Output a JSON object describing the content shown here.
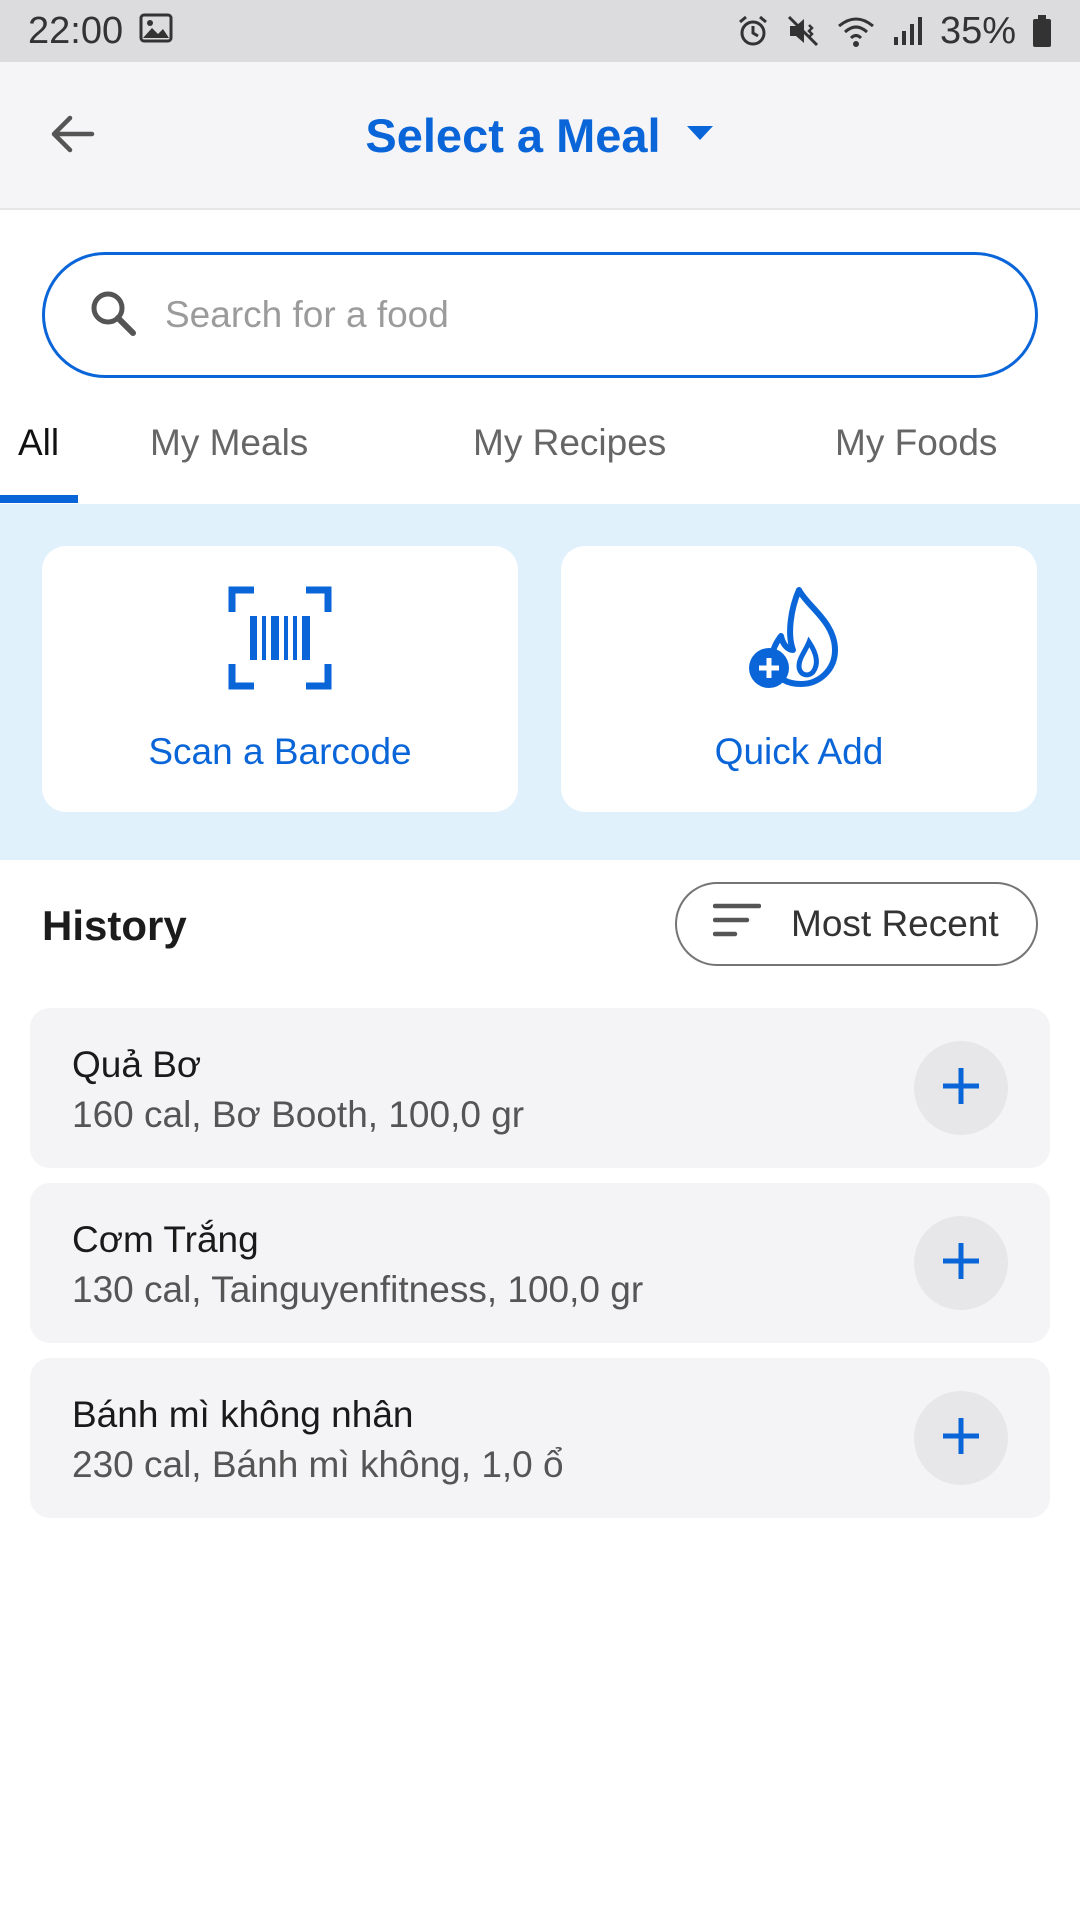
{
  "status_bar": {
    "time": "22:00",
    "battery": "35%",
    "icons": [
      "gallery-icon",
      "alarm-icon",
      "mute-icon",
      "wifi-icon",
      "signal-icon",
      "battery-icon"
    ]
  },
  "header": {
    "title": "Select a Meal",
    "back_icon": "arrow-left-icon",
    "dropdown_icon": "caret-down-icon"
  },
  "search": {
    "placeholder": "Search for a food",
    "value": ""
  },
  "tabs": [
    {
      "label": "All",
      "active": true
    },
    {
      "label": "My Meals",
      "active": false
    },
    {
      "label": "My Recipes",
      "active": false
    },
    {
      "label": "My Foods",
      "active": false
    }
  ],
  "quick_actions": [
    {
      "label": "Scan a Barcode",
      "icon": "barcode-scan-icon"
    },
    {
      "label": "Quick Add",
      "icon": "flame-plus-icon"
    }
  ],
  "history": {
    "title": "History",
    "sort_label": "Most Recent",
    "sort_icon": "sort-lines-icon",
    "items": [
      {
        "name": "Quả Bơ",
        "details": "160 cal, Bơ Booth, 100,0 gr"
      },
      {
        "name": "Cơm Trắng",
        "details": "130 cal, Tainguyenfitness, 100,0 gr"
      },
      {
        "name": "Bánh mì không nhân",
        "details": "230 cal, Bánh mì không, 1,0 ổ"
      }
    ]
  },
  "colors": {
    "accent": "#0a66d8",
    "actions_background": "#e1f1fc",
    "card_background": "#f4f4f6",
    "status_bar": "#dcdcde"
  }
}
